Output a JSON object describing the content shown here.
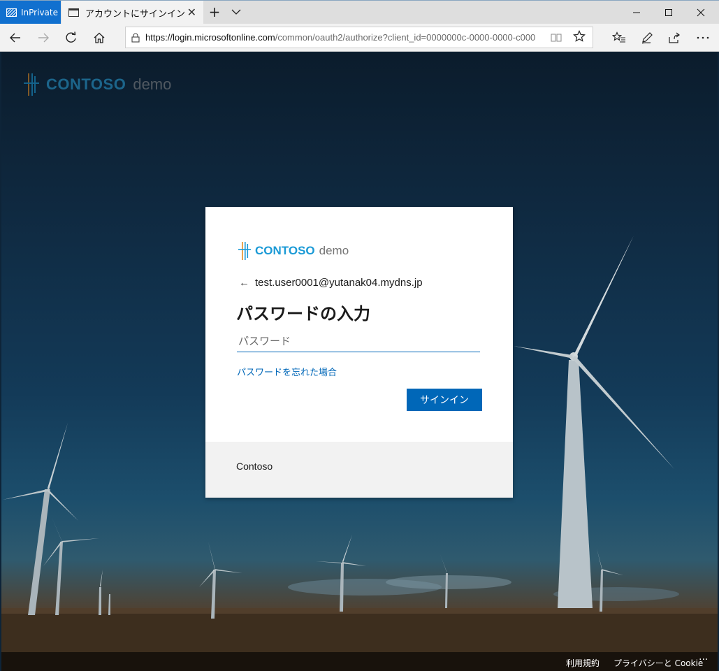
{
  "browser": {
    "inprivate_label": "InPrivate",
    "tab_title": "アカウントにサインイン",
    "tab_close": "✕",
    "new_tab": "+",
    "url_host": "https://login.microsoftonline.com",
    "url_rest": "/common/oauth2/authorize?client_id=0000000c-0000-0000-c000"
  },
  "page": {
    "brand_main": "CONTOSO",
    "brand_sub": "demo"
  },
  "card": {
    "brand_main": "CONTOSO",
    "brand_sub": "demo",
    "back_arrow": "←",
    "identity": "test.user0001@yutanak04.mydns.jp",
    "title": "パスワードの入力",
    "password_placeholder": "パスワード",
    "forgot_link": "パスワードを忘れた場合",
    "signin_button": "サインイン",
    "organization": "Contoso"
  },
  "footer": {
    "terms": "利用規約",
    "privacy": "プライバシーと Cookie",
    "more": "···"
  },
  "colors": {
    "accent": "#0067b8",
    "brand_blue": "#1b9ad6",
    "inprivate_blue": "#1170cf"
  }
}
